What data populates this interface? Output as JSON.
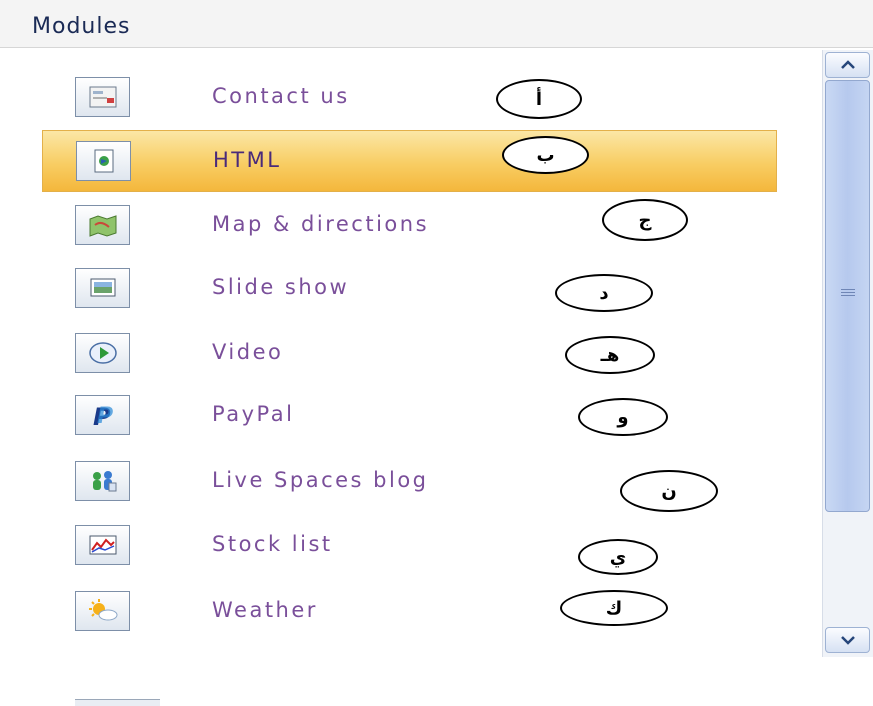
{
  "header": {
    "title": "Modules"
  },
  "modules": [
    {
      "label": "Contact us",
      "icon": "contact-card-icon",
      "marker": "أ",
      "selected": false
    },
    {
      "label": "HTML",
      "icon": "html-document-icon",
      "marker": "ب",
      "selected": true
    },
    {
      "label": "Map & directions",
      "icon": "map-icon",
      "marker": "ج",
      "selected": false
    },
    {
      "label": "Slide show",
      "icon": "slideshow-icon",
      "marker": "د",
      "selected": false
    },
    {
      "label": "Video",
      "icon": "video-play-icon",
      "marker": "هـ",
      "selected": false
    },
    {
      "label": "PayPal",
      "icon": "paypal-icon",
      "marker": "و",
      "selected": false
    },
    {
      "label": "Live Spaces blog",
      "icon": "live-spaces-blog-icon",
      "marker": "ن",
      "selected": false
    },
    {
      "label": "Stock list",
      "icon": "stock-chart-icon",
      "marker": "ي",
      "selected": false
    },
    {
      "label": "Weather",
      "icon": "weather-sun-cloud-icon",
      "marker": "ك",
      "selected": false
    }
  ],
  "colors": {
    "selected_bg": "#f8cd63",
    "label_text": "#7a4f9a",
    "header_text": "#1a2a55"
  }
}
